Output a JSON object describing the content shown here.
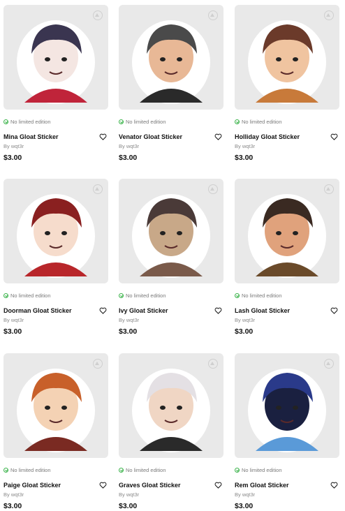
{
  "products": [
    {
      "name": "Mina Gloat Sticker",
      "edition": "No limited edition",
      "by": "By wqt3r",
      "price": "$3.00",
      "hair": "#3a3550",
      "skin": "#f4e6e2",
      "accent": "#c0243a"
    },
    {
      "name": "Venator Gloat Sticker",
      "edition": "No limited edition",
      "by": "By wqt3r",
      "price": "$3.00",
      "hair": "#4a4a4a",
      "skin": "#e8b896",
      "accent": "#2a2a2a"
    },
    {
      "name": "Holliday Gloat Sticker",
      "edition": "No limited edition",
      "by": "By wqt3r",
      "price": "$3.00",
      "hair": "#6b3a2a",
      "skin": "#f0c4a0",
      "accent": "#c87a3a"
    },
    {
      "name": "Doorman Gloat Sticker",
      "edition": "No limited edition",
      "by": "By wqt3r",
      "price": "$3.00",
      "hair": "#8a2020",
      "skin": "#f6dccc",
      "accent": "#b8262a"
    },
    {
      "name": "Ivy Gloat Sticker",
      "edition": "No limited edition",
      "by": "By wqt3r",
      "price": "$3.00",
      "hair": "#4a3a38",
      "skin": "#c8a888",
      "accent": "#7a5a4a"
    },
    {
      "name": "Lash Gloat Sticker",
      "edition": "No limited edition",
      "by": "By wqt3r",
      "price": "$3.00",
      "hair": "#3a2a22",
      "skin": "#e0a27c",
      "accent": "#6a4a2a"
    },
    {
      "name": "Paige Gloat Sticker",
      "edition": "No limited edition",
      "by": "By wqt3r",
      "price": "$3.00",
      "hair": "#c8602a",
      "skin": "#f4d2b4",
      "accent": "#7a2a22"
    },
    {
      "name": "Graves Gloat Sticker",
      "edition": "No limited edition",
      "by": "By wqt3r",
      "price": "$3.00",
      "hair": "#e4e0e4",
      "skin": "#f0d6c4",
      "accent": "#2a2a2a"
    },
    {
      "name": "Rem Gloat Sticker",
      "edition": "No limited edition",
      "by": "By wqt3r",
      "price": "$3.00",
      "hair": "#2a3a8a",
      "skin": "#1a2040",
      "accent": "#5a9ad8"
    }
  ],
  "icons": {
    "favorite": "heart-icon",
    "edition": "check-circle-icon",
    "watermark": "logo-icon"
  }
}
